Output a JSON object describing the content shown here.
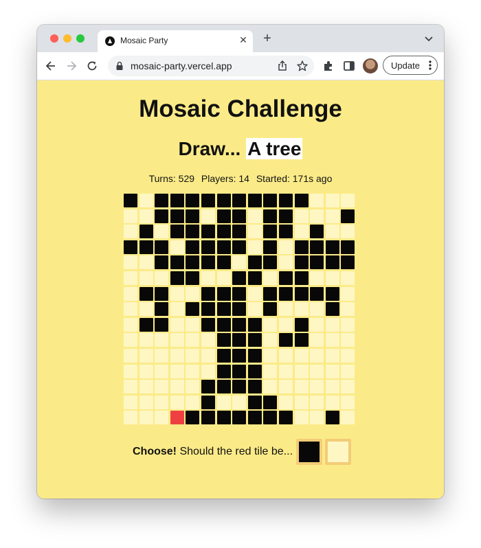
{
  "browser": {
    "tab_title": "Mosaic Party",
    "tab_close": "✕",
    "new_tab": "+",
    "url": "mosaic-party.vercel.app",
    "update_label": "Update"
  },
  "page": {
    "title": "Mosaic Challenge",
    "draw_prefix": "Draw...",
    "draw_word": "A tree",
    "stats": {
      "turns": "Turns: 529",
      "players": "Players: 14",
      "started": "Started: 171s ago"
    },
    "choose_label": "Choose!",
    "choose_question": "Should the red tile be..."
  },
  "colors": {
    "background": "#fbeb88",
    "filled": "#080808",
    "empty": "#fef6c3",
    "highlight": "#ee4040",
    "option_border": "#f3cc77"
  },
  "mosaic": {
    "rows": 15,
    "cols": 15,
    "legend": {
      "1": "black",
      "0": "cream",
      "2": "red"
    },
    "grid": [
      "101111111111000",
      "001110110110001",
      "010111110110100",
      "111011110101111",
      "001111101101111",
      "000110011011000",
      "011001110111110",
      "001011110100010",
      "011001111001000",
      "000000111011000",
      "000000111000000",
      "000000111000000",
      "000001111000000",
      "000001001100000",
      "000211111110010"
    ]
  },
  "options": [
    "black",
    "cream"
  ]
}
